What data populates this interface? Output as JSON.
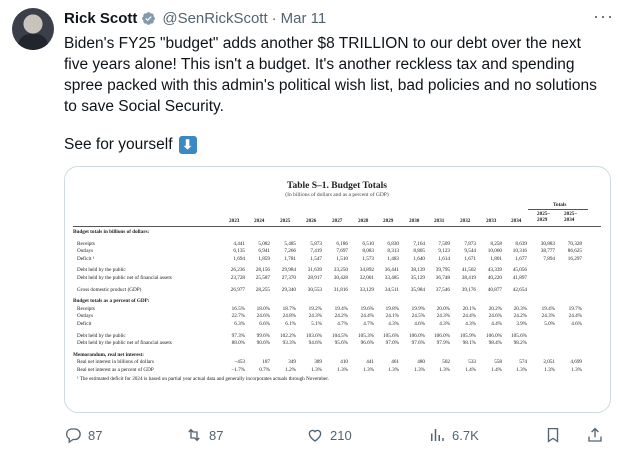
{
  "tweet": {
    "author_name": "Rick Scott",
    "handle": "@SenRickScott",
    "separator": "·",
    "date": "Mar 11",
    "text": "Biden's FY25 \"budget\" adds another $8 TRILLION to our debt over the next five years alone! This isn't a budget. It's another reckless tax and spending spree packed with this admin's political wish list, bad policies and no solutions to save Social Security.",
    "see_for_yourself": "See for yourself",
    "arrow_glyph": "⬇"
  },
  "table": {
    "title": "Table S–1.  Budget Totals",
    "subtitle": "(In billions of dollars and as a percent of GDP)",
    "totals_label": "Totals",
    "years": [
      "2023",
      "2024",
      "2025",
      "2026",
      "2027",
      "2028",
      "2029",
      "2030",
      "2031",
      "2032",
      "2033",
      "2034"
    ],
    "total_cols": [
      "2025–\n2029",
      "2025–\n2034"
    ],
    "rows": [
      {
        "label": "Budget totals in billions of dollars:",
        "section": true,
        "values": []
      },
      {
        "label": "Receipts",
        "values": [
          "4,441",
          "5,082",
          "5,485",
          "5,873",
          "6,186",
          "6,510",
          "6,830",
          "7,164",
          "7,509",
          "7,873",
          "8,258",
          "8,639",
          "30,883",
          "70,328"
        ]
      },
      {
        "label": "Outlays",
        "values": [
          "6,135",
          "6,941",
          "7,266",
          "7,419",
          "7,697",
          "8,083",
          "8,313",
          "8,805",
          "9,123",
          "9,544",
          "10,060",
          "10,316",
          "38,777",
          "86,625"
        ]
      },
      {
        "label": "Deficit ¹",
        "values": [
          "1,694",
          "1,859",
          "1,781",
          "1,547",
          "1,510",
          "1,573",
          "1,483",
          "1,640",
          "1,614",
          "1,671",
          "1,801",
          "1,677",
          "7,894",
          "16,297"
        ]
      },
      {
        "label": "Debt held by the public",
        "values": [
          "26,236",
          "28,156",
          "29,984",
          "31,639",
          "33,250",
          "34,892",
          "36,441",
          "38,139",
          "39,795",
          "41,502",
          "43,339",
          "45,056",
          "",
          ""
        ]
      },
      {
        "label": "Debt held by the public net of financial assets",
        "values": [
          "23,728",
          "25,587",
          "27,370",
          "28,917",
          "30,428",
          "32,001",
          "33,485",
          "35,129",
          "36,748",
          "38,419",
          "40,220",
          "41,897",
          "",
          ""
        ]
      },
      {
        "label": "Gross domestic product (GDP)",
        "values": [
          "26,977",
          "28,255",
          "29,340",
          "30,553",
          "31,816",
          "33,129",
          "34,511",
          "35,984",
          "37,546",
          "39,176",
          "40,877",
          "42,654",
          "",
          ""
        ]
      },
      {
        "label": "Budget totals as a percent of GDP:",
        "section": true,
        "values": []
      },
      {
        "label": "Receipts",
        "values": [
          "16.5%",
          "18.0%",
          "18.7%",
          "19.2%",
          "19.4%",
          "19.6%",
          "19.8%",
          "19.9%",
          "20.0%",
          "20.1%",
          "20.2%",
          "20.3%",
          "19.4%",
          "19.7%"
        ]
      },
      {
        "label": "Outlays",
        "values": [
          "22.7%",
          "24.6%",
          "24.8%",
          "24.3%",
          "24.2%",
          "24.4%",
          "24.1%",
          "24.5%",
          "24.3%",
          "24.4%",
          "24.6%",
          "24.2%",
          "24.3%",
          "24.4%"
        ]
      },
      {
        "label": "Deficit",
        "values": [
          "6.3%",
          "6.6%",
          "6.1%",
          "5.1%",
          "4.7%",
          "4.7%",
          "4.3%",
          "4.6%",
          "4.3%",
          "4.3%",
          "4.4%",
          "3.9%",
          "5.0%",
          "4.6%"
        ]
      },
      {
        "label": "Debt held by the public",
        "values": [
          "97.3%",
          "99.6%",
          "102.2%",
          "103.6%",
          "104.5%",
          "105.3%",
          "105.6%",
          "106.0%",
          "106.0%",
          "105.9%",
          "106.0%",
          "105.6%",
          "",
          ""
        ]
      },
      {
        "label": "Debt held by the public net of financial assets",
        "values": [
          "88.0%",
          "90.6%",
          "93.3%",
          "94.6%",
          "95.6%",
          "96.6%",
          "97.0%",
          "97.6%",
          "97.9%",
          "98.1%",
          "98.4%",
          "98.2%",
          "",
          ""
        ]
      },
      {
        "label": "Memorandum, real net interest:",
        "section": true,
        "values": []
      },
      {
        "label": "Real net interest in billions of dollars",
        "values": [
          "–453",
          "187",
          "349",
          "389",
          "410",
          "441",
          "461",
          "480",
          "502",
          "533",
          "558",
          "574",
          "2,051",
          "4,699"
        ]
      },
      {
        "label": "Real net interest as a percent of GDP",
        "values": [
          "–1.7%",
          "0.7%",
          "1.2%",
          "1.3%",
          "1.3%",
          "1.3%",
          "1.3%",
          "1.3%",
          "1.3%",
          "1.4%",
          "1.4%",
          "1.3%",
          "1.3%",
          "1.3%"
        ]
      }
    ],
    "footnote": "¹ The estimated deficit for 2024 is based on partial year actual data and generally incorporates actuals through November."
  },
  "actions": {
    "replies": "87",
    "reposts": "87",
    "likes": "210",
    "views": "6.7K"
  },
  "colors": {
    "accent": "#1d9bf0",
    "muted": "#536471",
    "border": "#cfd9de",
    "badge": "#829aab"
  }
}
